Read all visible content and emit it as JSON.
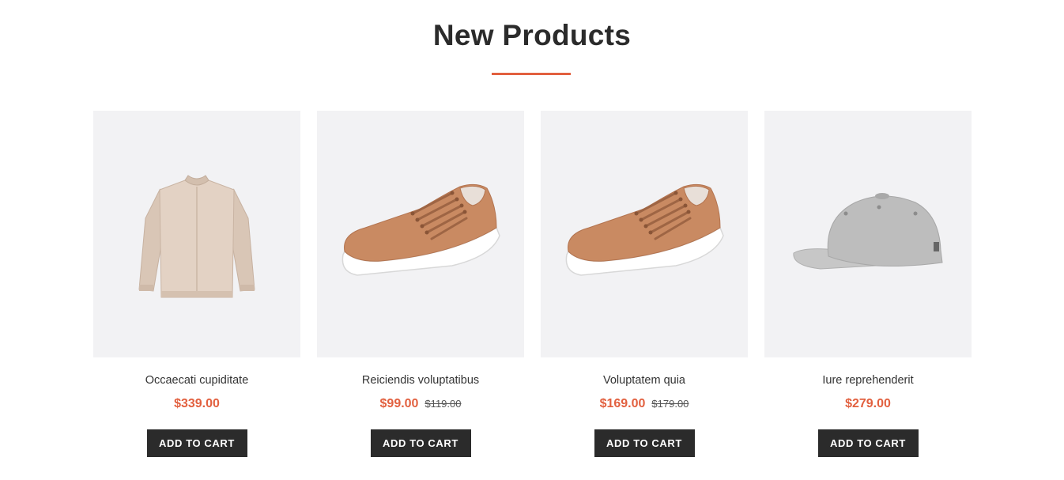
{
  "section": {
    "title": "New Products",
    "accent_color": "#e2603f"
  },
  "products": [
    {
      "name": "Occaecati cupiditate",
      "price": "$339.00",
      "old_price": "",
      "image_icon": "jacket-image",
      "button_label": "ADD TO CART"
    },
    {
      "name": "Reiciendis voluptatibus",
      "price": "$99.00",
      "old_price": "$119.00",
      "image_icon": "sneaker-image",
      "button_label": "ADD TO CART"
    },
    {
      "name": "Voluptatem quia",
      "price": "$169.00",
      "old_price": "$179.00",
      "image_icon": "sneaker-image",
      "button_label": "ADD TO CART"
    },
    {
      "name": "Iure reprehenderit",
      "price": "$279.00",
      "old_price": "",
      "image_icon": "cap-image",
      "button_label": "ADD TO CART"
    }
  ]
}
